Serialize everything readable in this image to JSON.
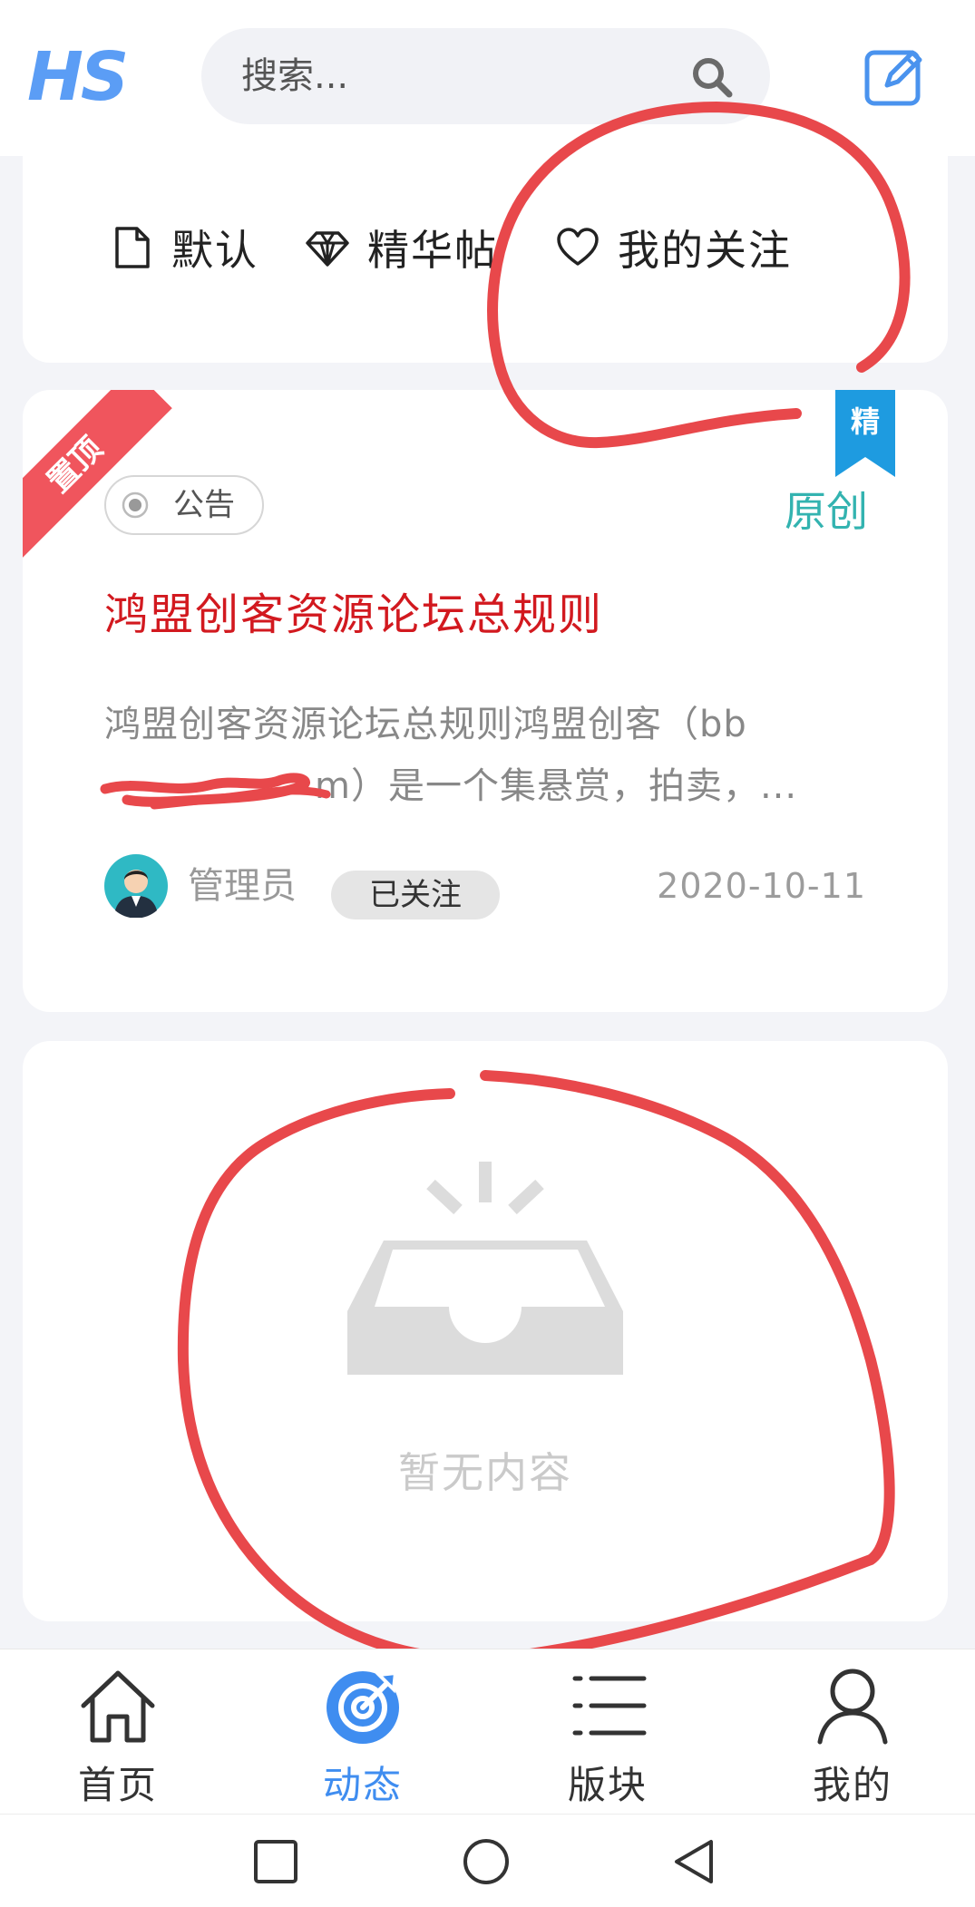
{
  "header": {
    "logo": "HS",
    "search_placeholder": "搜索..."
  },
  "filters": [
    {
      "label": "默认",
      "icon": "file-icon"
    },
    {
      "label": "精华帖",
      "icon": "diamond-icon"
    },
    {
      "label": "我的关注",
      "icon": "heart-icon"
    }
  ],
  "post": {
    "pinned_label": "置顶",
    "featured_label": "精",
    "original_label": "原创",
    "tag": "公告",
    "title": "鸿盟创客资源论坛总规则",
    "excerpt_line1": "鸿盟创客资源论坛总规则鸿盟创客（bb",
    "excerpt_line2": "m）是一个集悬赏，拍卖，...",
    "author": "管理员",
    "follow_status": "已关注",
    "date": "2020-10-11"
  },
  "empty_state": {
    "text": "暂无内容"
  },
  "tabs": [
    {
      "label": "首页",
      "icon": "home-icon"
    },
    {
      "label": "动态",
      "icon": "target-icon",
      "active": true
    },
    {
      "label": "版块",
      "icon": "list-icon"
    },
    {
      "label": "我的",
      "icon": "user-icon"
    }
  ],
  "colors": {
    "accent": "#3f8df0",
    "title_red": "#d2191f",
    "original_teal": "#33b3b0",
    "pinned_red": "#f0555d",
    "featured_blue": "#1e9be0",
    "annotation_red": "#e8484b"
  }
}
